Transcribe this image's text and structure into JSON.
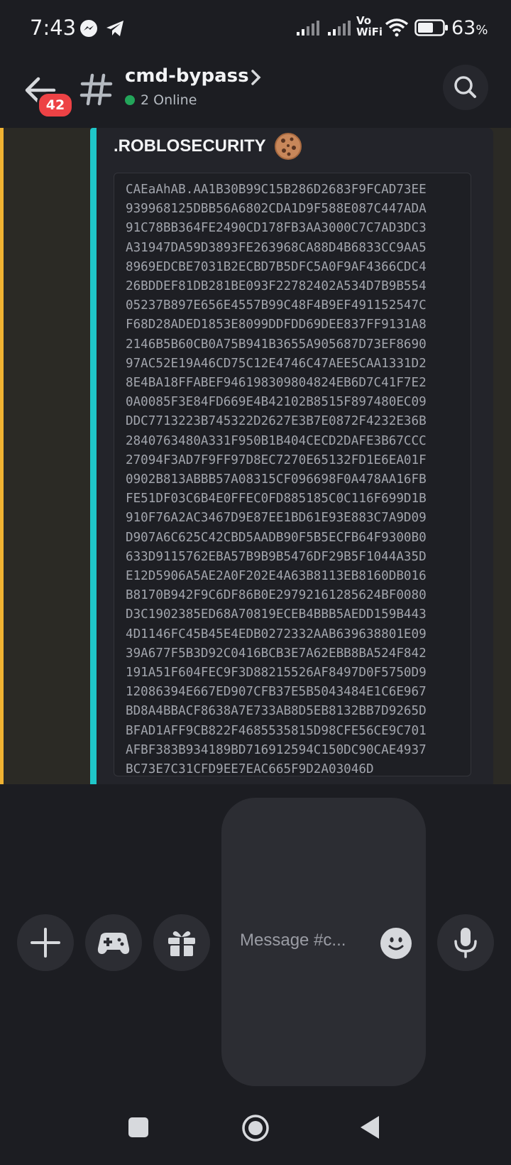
{
  "status_bar": {
    "time": "7:43",
    "network_label": "Vo WiFi",
    "battery_percent": "63",
    "battery_unit": "%",
    "battery_level": 0.63,
    "notification_icons": [
      "messenger-icon",
      "telegram-icon"
    ]
  },
  "header": {
    "unread_badge": "42",
    "channel_name": "cmd-bypass",
    "online_text": "2 Online"
  },
  "embed": {
    "title": ".ROBLOSECURITY",
    "title_emoji": "cookie-icon",
    "accent_color": "#1fc7c9",
    "code_lines": [
      "CAEaAhAB.AA1B30B99C15B286D2683F9FCAD73EE",
      "939968125DBB56A6802CDA1D9F588E087C447ADA",
      "91C78BB364FE2490CD178FB3AA3000C7C7AD3DC3",
      "A31947DA59D3893FE263968CA88D4B6833CC9AA5",
      "8969EDCBE7031B2ECBD7B5DFC5A0F9AF4366CDC4",
      "26BDDEF81DB281BE093F22782402A534D7B9B554",
      "05237B897E656E4557B99C48F4B9EF491152547C",
      "F68D28ADED1853E8099DDFDD69DEE837FF9131A8",
      "2146B5B60CB0A75B941B3655A905687D73EF8690",
      "97AC52E19A46CD75C12E4746C47AEE5CAA1331D2",
      "8E4BA18FFABEF946198309804824EB6D7C41F7E2",
      "0A0085F3E84FD669E4B42102B8515F897480EC09",
      "DDC7713223B745322D2627E3B7E0872F4232E36B",
      "2840763480A331F950B1B404CECD2DAFE3B67CCC",
      "27094F3AD7F9FF97D8EC7270E65132FD1E6EA01F",
      "0902B813ABBB57A08315CF096698F0A478AA16FB",
      "FE51DF03C6B4E0FFEC0FD885185C0C116F699D1B",
      "910F76A2AC3467D9E87EE1BD61E93E883C7A9D09",
      "D907A6C625C42CBD5AADB90F5B5ECFB64F9300B0",
      "633D9115762EBA57B9B9B5476DF29B5F1044A35D",
      "E12D5906A5AE2A0F202E4A63B8113EB8160DB016",
      "B8170B942F9C6DF86B0E29792161285624BF0080",
      "D3C1902385ED68A70819ECEB4BBB5AEDD159B443",
      "4D1146FC45B45E4EDB0272332AAB639638801E09",
      "39A677F5B3D92C0416BCB3E7A62EBB8BA524F842",
      "191A51F604FEC9F3D88215526AF8497D0F5750D9",
      "12086394E667ED907CFB37E5B5043484E1C6E967",
      "BD8A4BBACF8638A7E733AB8D5EB8132BB7D9265D",
      "BFAD1AFF9CB822F4685535815D98CFE56CE9C701",
      "AFBF383B934189BD716912594C150DC90CAE4937",
      "BC73E7C31CFD9EE7EAC665F9D2A03046D"
    ]
  },
  "composer": {
    "placeholder": "Message #c...",
    "buttons": [
      "plus-icon",
      "gamepad-icon",
      "gift-icon",
      "emoji-icon",
      "microphone-icon"
    ]
  },
  "colors": {
    "background": "#1c1d22",
    "mention_highlight": "#f0b232",
    "badge": "#ed4245",
    "online": "#23a55a"
  }
}
